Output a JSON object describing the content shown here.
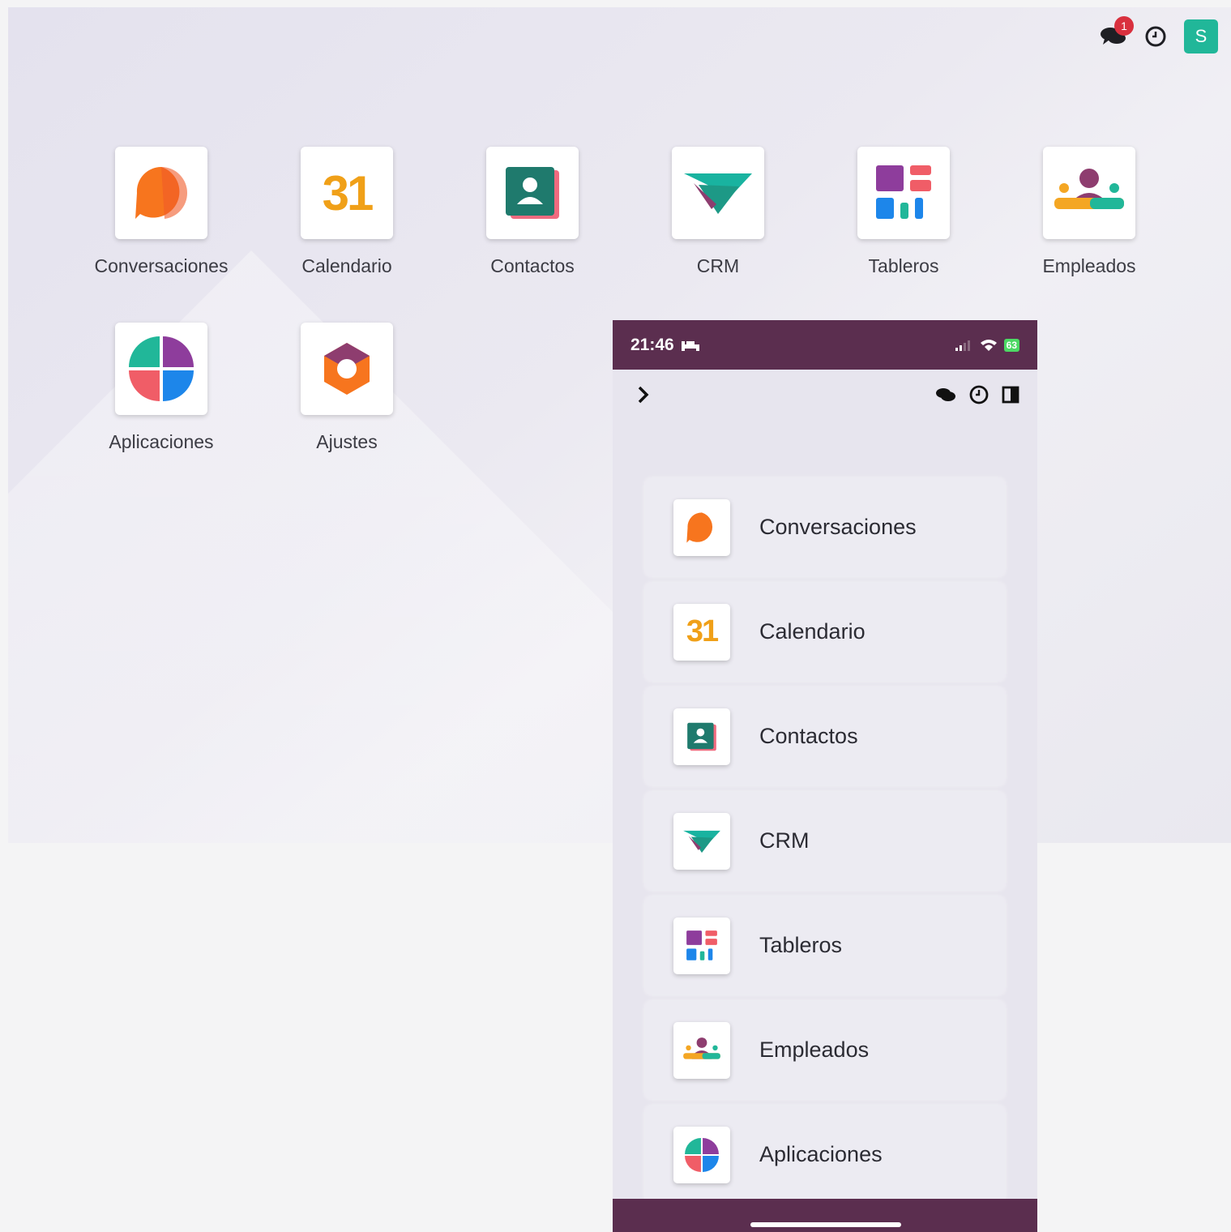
{
  "desktop": {
    "topbar": {
      "notification_count": "1",
      "avatar_letter": "S",
      "avatar_color": "#21b799"
    },
    "apps": [
      {
        "label": "Conversaciones",
        "icon": "discuss-icon"
      },
      {
        "label": "Calendario",
        "icon": "calendar-icon"
      },
      {
        "label": "Contactos",
        "icon": "contacts-icon"
      },
      {
        "label": "CRM",
        "icon": "crm-icon"
      },
      {
        "label": "Tableros",
        "icon": "dashboards-icon"
      },
      {
        "label": "Empleados",
        "icon": "employees-icon"
      },
      {
        "label": "Aplicaciones",
        "icon": "apps-icon"
      },
      {
        "label": "Ajustes",
        "icon": "settings-icon"
      }
    ]
  },
  "phone": {
    "status": {
      "time": "21:46",
      "battery": "63"
    },
    "apps": [
      {
        "label": "Conversaciones",
        "icon": "discuss-icon"
      },
      {
        "label": "Calendario",
        "icon": "calendar-icon"
      },
      {
        "label": "Contactos",
        "icon": "contacts-icon"
      },
      {
        "label": "CRM",
        "icon": "crm-icon"
      },
      {
        "label": "Tableros",
        "icon": "dashboards-icon"
      },
      {
        "label": "Empleados",
        "icon": "employees-icon"
      },
      {
        "label": "Aplicaciones",
        "icon": "apps-icon"
      }
    ],
    "bar_color": "#5b2e4f"
  },
  "icon_labels": {
    "calendar_number": "31"
  }
}
